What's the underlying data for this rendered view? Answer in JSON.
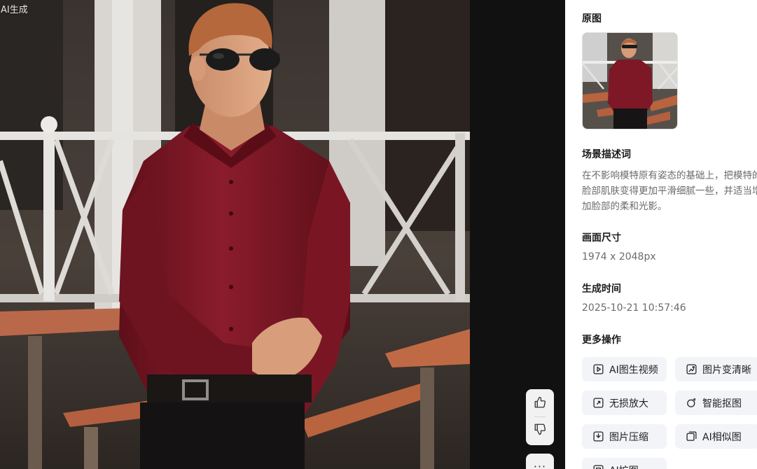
{
  "viewer": {
    "badge": "AI生成",
    "like_icon": "thumbs-up-icon",
    "dislike_icon": "thumbs-down-icon",
    "more_label": "···"
  },
  "panel": {
    "original": {
      "title": "原图"
    },
    "scene": {
      "title": "场景描述词",
      "text": "在不影响模特原有姿态的基础上，把模特的脸部肌肤变得更加平滑细腻一些，并适当增加脸部的柔和光影。"
    },
    "size": {
      "title": "画面尺寸",
      "value": "1974 x 2048px"
    },
    "time": {
      "title": "生成时间",
      "value": "2025-10-21 10:57:46"
    },
    "more_ops": {
      "title": "更多操作",
      "buttons": [
        {
          "label": "AI图生视频",
          "icon": "video-icon"
        },
        {
          "label": "图片变清晰",
          "icon": "enhance-icon"
        },
        {
          "label": "无损放大",
          "icon": "upscale-icon"
        },
        {
          "label": "智能抠图",
          "icon": "cutout-icon"
        },
        {
          "label": "图片压缩",
          "icon": "compress-icon"
        },
        {
          "label": "AI相似图",
          "icon": "similar-icon"
        },
        {
          "label": "AI扩图",
          "icon": "expand-icon"
        }
      ]
    }
  },
  "colors": {
    "shirt": "#7a1624",
    "panel_button_bg": "#f2f4f7",
    "viewer_bg": "#111111"
  }
}
